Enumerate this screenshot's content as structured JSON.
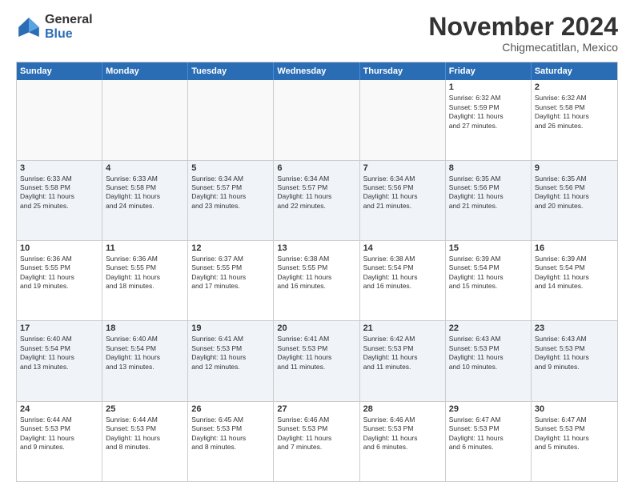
{
  "logo": {
    "general": "General",
    "blue": "Blue"
  },
  "title": "November 2024",
  "location": "Chigmecatitlan, Mexico",
  "header_days": [
    "Sunday",
    "Monday",
    "Tuesday",
    "Wednesday",
    "Thursday",
    "Friday",
    "Saturday"
  ],
  "rows": [
    [
      {
        "day": "",
        "info": ""
      },
      {
        "day": "",
        "info": ""
      },
      {
        "day": "",
        "info": ""
      },
      {
        "day": "",
        "info": ""
      },
      {
        "day": "",
        "info": ""
      },
      {
        "day": "1",
        "info": "Sunrise: 6:32 AM\nSunset: 5:59 PM\nDaylight: 11 hours\nand 27 minutes."
      },
      {
        "day": "2",
        "info": "Sunrise: 6:32 AM\nSunset: 5:58 PM\nDaylight: 11 hours\nand 26 minutes."
      }
    ],
    [
      {
        "day": "3",
        "info": "Sunrise: 6:33 AM\nSunset: 5:58 PM\nDaylight: 11 hours\nand 25 minutes."
      },
      {
        "day": "4",
        "info": "Sunrise: 6:33 AM\nSunset: 5:58 PM\nDaylight: 11 hours\nand 24 minutes."
      },
      {
        "day": "5",
        "info": "Sunrise: 6:34 AM\nSunset: 5:57 PM\nDaylight: 11 hours\nand 23 minutes."
      },
      {
        "day": "6",
        "info": "Sunrise: 6:34 AM\nSunset: 5:57 PM\nDaylight: 11 hours\nand 22 minutes."
      },
      {
        "day": "7",
        "info": "Sunrise: 6:34 AM\nSunset: 5:56 PM\nDaylight: 11 hours\nand 21 minutes."
      },
      {
        "day": "8",
        "info": "Sunrise: 6:35 AM\nSunset: 5:56 PM\nDaylight: 11 hours\nand 21 minutes."
      },
      {
        "day": "9",
        "info": "Sunrise: 6:35 AM\nSunset: 5:56 PM\nDaylight: 11 hours\nand 20 minutes."
      }
    ],
    [
      {
        "day": "10",
        "info": "Sunrise: 6:36 AM\nSunset: 5:55 PM\nDaylight: 11 hours\nand 19 minutes."
      },
      {
        "day": "11",
        "info": "Sunrise: 6:36 AM\nSunset: 5:55 PM\nDaylight: 11 hours\nand 18 minutes."
      },
      {
        "day": "12",
        "info": "Sunrise: 6:37 AM\nSunset: 5:55 PM\nDaylight: 11 hours\nand 17 minutes."
      },
      {
        "day": "13",
        "info": "Sunrise: 6:38 AM\nSunset: 5:55 PM\nDaylight: 11 hours\nand 16 minutes."
      },
      {
        "day": "14",
        "info": "Sunrise: 6:38 AM\nSunset: 5:54 PM\nDaylight: 11 hours\nand 16 minutes."
      },
      {
        "day": "15",
        "info": "Sunrise: 6:39 AM\nSunset: 5:54 PM\nDaylight: 11 hours\nand 15 minutes."
      },
      {
        "day": "16",
        "info": "Sunrise: 6:39 AM\nSunset: 5:54 PM\nDaylight: 11 hours\nand 14 minutes."
      }
    ],
    [
      {
        "day": "17",
        "info": "Sunrise: 6:40 AM\nSunset: 5:54 PM\nDaylight: 11 hours\nand 13 minutes."
      },
      {
        "day": "18",
        "info": "Sunrise: 6:40 AM\nSunset: 5:54 PM\nDaylight: 11 hours\nand 13 minutes."
      },
      {
        "day": "19",
        "info": "Sunrise: 6:41 AM\nSunset: 5:53 PM\nDaylight: 11 hours\nand 12 minutes."
      },
      {
        "day": "20",
        "info": "Sunrise: 6:41 AM\nSunset: 5:53 PM\nDaylight: 11 hours\nand 11 minutes."
      },
      {
        "day": "21",
        "info": "Sunrise: 6:42 AM\nSunset: 5:53 PM\nDaylight: 11 hours\nand 11 minutes."
      },
      {
        "day": "22",
        "info": "Sunrise: 6:43 AM\nSunset: 5:53 PM\nDaylight: 11 hours\nand 10 minutes."
      },
      {
        "day": "23",
        "info": "Sunrise: 6:43 AM\nSunset: 5:53 PM\nDaylight: 11 hours\nand 9 minutes."
      }
    ],
    [
      {
        "day": "24",
        "info": "Sunrise: 6:44 AM\nSunset: 5:53 PM\nDaylight: 11 hours\nand 9 minutes."
      },
      {
        "day": "25",
        "info": "Sunrise: 6:44 AM\nSunset: 5:53 PM\nDaylight: 11 hours\nand 8 minutes."
      },
      {
        "day": "26",
        "info": "Sunrise: 6:45 AM\nSunset: 5:53 PM\nDaylight: 11 hours\nand 8 minutes."
      },
      {
        "day": "27",
        "info": "Sunrise: 6:46 AM\nSunset: 5:53 PM\nDaylight: 11 hours\nand 7 minutes."
      },
      {
        "day": "28",
        "info": "Sunrise: 6:46 AM\nSunset: 5:53 PM\nDaylight: 11 hours\nand 6 minutes."
      },
      {
        "day": "29",
        "info": "Sunrise: 6:47 AM\nSunset: 5:53 PM\nDaylight: 11 hours\nand 6 minutes."
      },
      {
        "day": "30",
        "info": "Sunrise: 6:47 AM\nSunset: 5:53 PM\nDaylight: 11 hours\nand 5 minutes."
      }
    ]
  ]
}
